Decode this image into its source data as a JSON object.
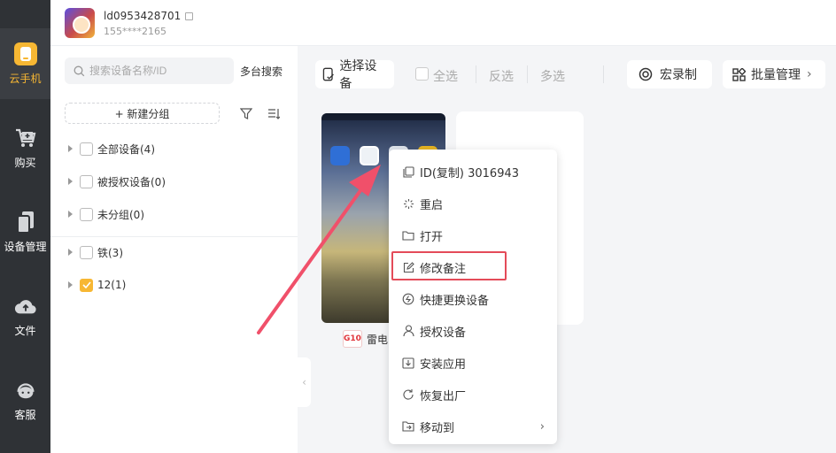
{
  "sidebar": {
    "items": [
      {
        "label": "云手机",
        "icon": "phone-icon",
        "active": true
      },
      {
        "label": "购买",
        "icon": "cart-icon"
      },
      {
        "label": "设备管理",
        "icon": "devices-icon"
      },
      {
        "label": "文件",
        "icon": "cloud-upload-icon"
      },
      {
        "label": "客服",
        "icon": "headset-icon"
      }
    ]
  },
  "account": {
    "id": "ld0953428701",
    "phone": "155****2165"
  },
  "left_panel": {
    "search_placeholder": "搜索设备名称/ID",
    "multi_search": "多台搜索",
    "new_group": "+ 新建分组",
    "groups": [
      {
        "label": "全部设备(4)",
        "checked": false
      },
      {
        "label": "被授权设备(0)",
        "checked": false
      },
      {
        "label": "未分组(0)",
        "checked": false
      },
      {
        "label": "铁(3)",
        "checked": false
      },
      {
        "label": "12(1)",
        "checked": true
      }
    ]
  },
  "toolbar": {
    "select_device": "选择设备",
    "select_all": "全选",
    "invert": "反选",
    "multi_select": "多选",
    "macro": "宏录制",
    "batch": "批量管理"
  },
  "device": {
    "logo": "G10",
    "name": "雷电"
  },
  "context_menu": {
    "items": [
      {
        "label": "ID(复制) 3016943",
        "icon": "copy-icon"
      },
      {
        "label": "重启",
        "icon": "loading-icon"
      },
      {
        "label": "打开",
        "icon": "folder-icon"
      },
      {
        "label": "修改备注",
        "icon": "edit-icon",
        "highlighted": true
      },
      {
        "label": "快捷更换设备",
        "icon": "swap-icon"
      },
      {
        "label": "授权设备",
        "icon": "user-icon"
      },
      {
        "label": "安装应用",
        "icon": "download-icon"
      },
      {
        "label": "恢复出厂",
        "icon": "refresh-icon"
      },
      {
        "label": "移动到",
        "icon": "move-icon",
        "submenu": true
      }
    ]
  },
  "colors": {
    "accent": "#f7b733",
    "highlight": "#e44b59",
    "rail": "#2f3236"
  }
}
